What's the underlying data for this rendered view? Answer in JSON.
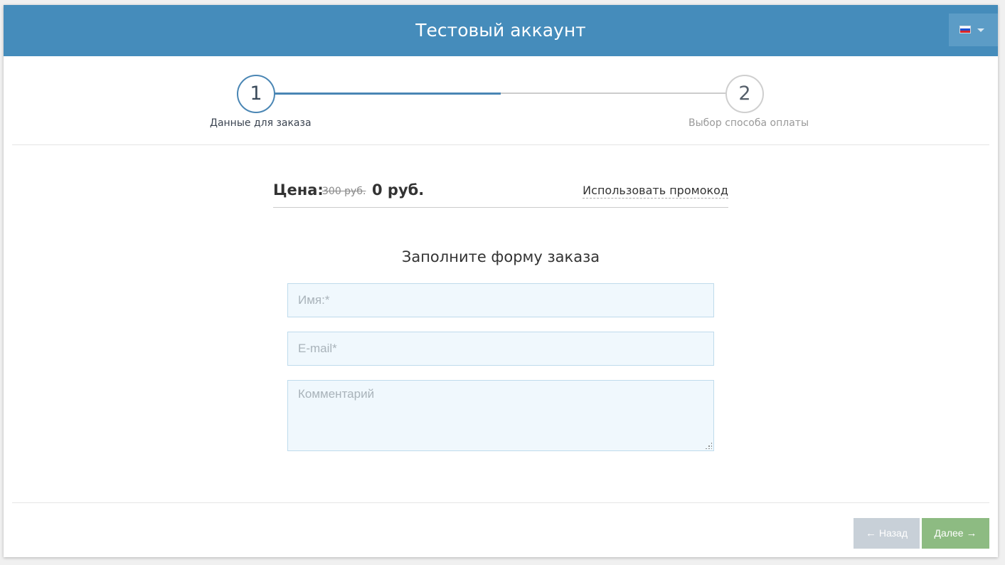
{
  "header": {
    "title": "Тестовый аккаунт",
    "language": {
      "flag": "russia-flag-icon",
      "selected": "ru"
    }
  },
  "steps": [
    {
      "number": "1",
      "label": "Данные для заказа",
      "active": true
    },
    {
      "number": "2",
      "label": "Выбор способа оплаты",
      "active": false
    }
  ],
  "price": {
    "label": "Цена:",
    "old": "300 руб.",
    "new": "0 руб.",
    "promo_link": "Использовать промокод"
  },
  "form": {
    "title": "Заполните форму заказа",
    "name_placeholder": "Имя:*",
    "name_value": "",
    "email_placeholder": "E-mail*",
    "email_value": "",
    "comment_placeholder": "Комментарий",
    "comment_value": ""
  },
  "nav": {
    "back_label": "Назад",
    "next_label": "Далее",
    "back_icon": "arrow-left-icon",
    "next_icon": "arrow-right-icon"
  },
  "colors": {
    "header_bg": "#458cbb",
    "step_active": "#4a86b4",
    "field_bg": "#f0f8fd",
    "back_button": "#c8d0d8",
    "next_button": "#8dbb82"
  }
}
